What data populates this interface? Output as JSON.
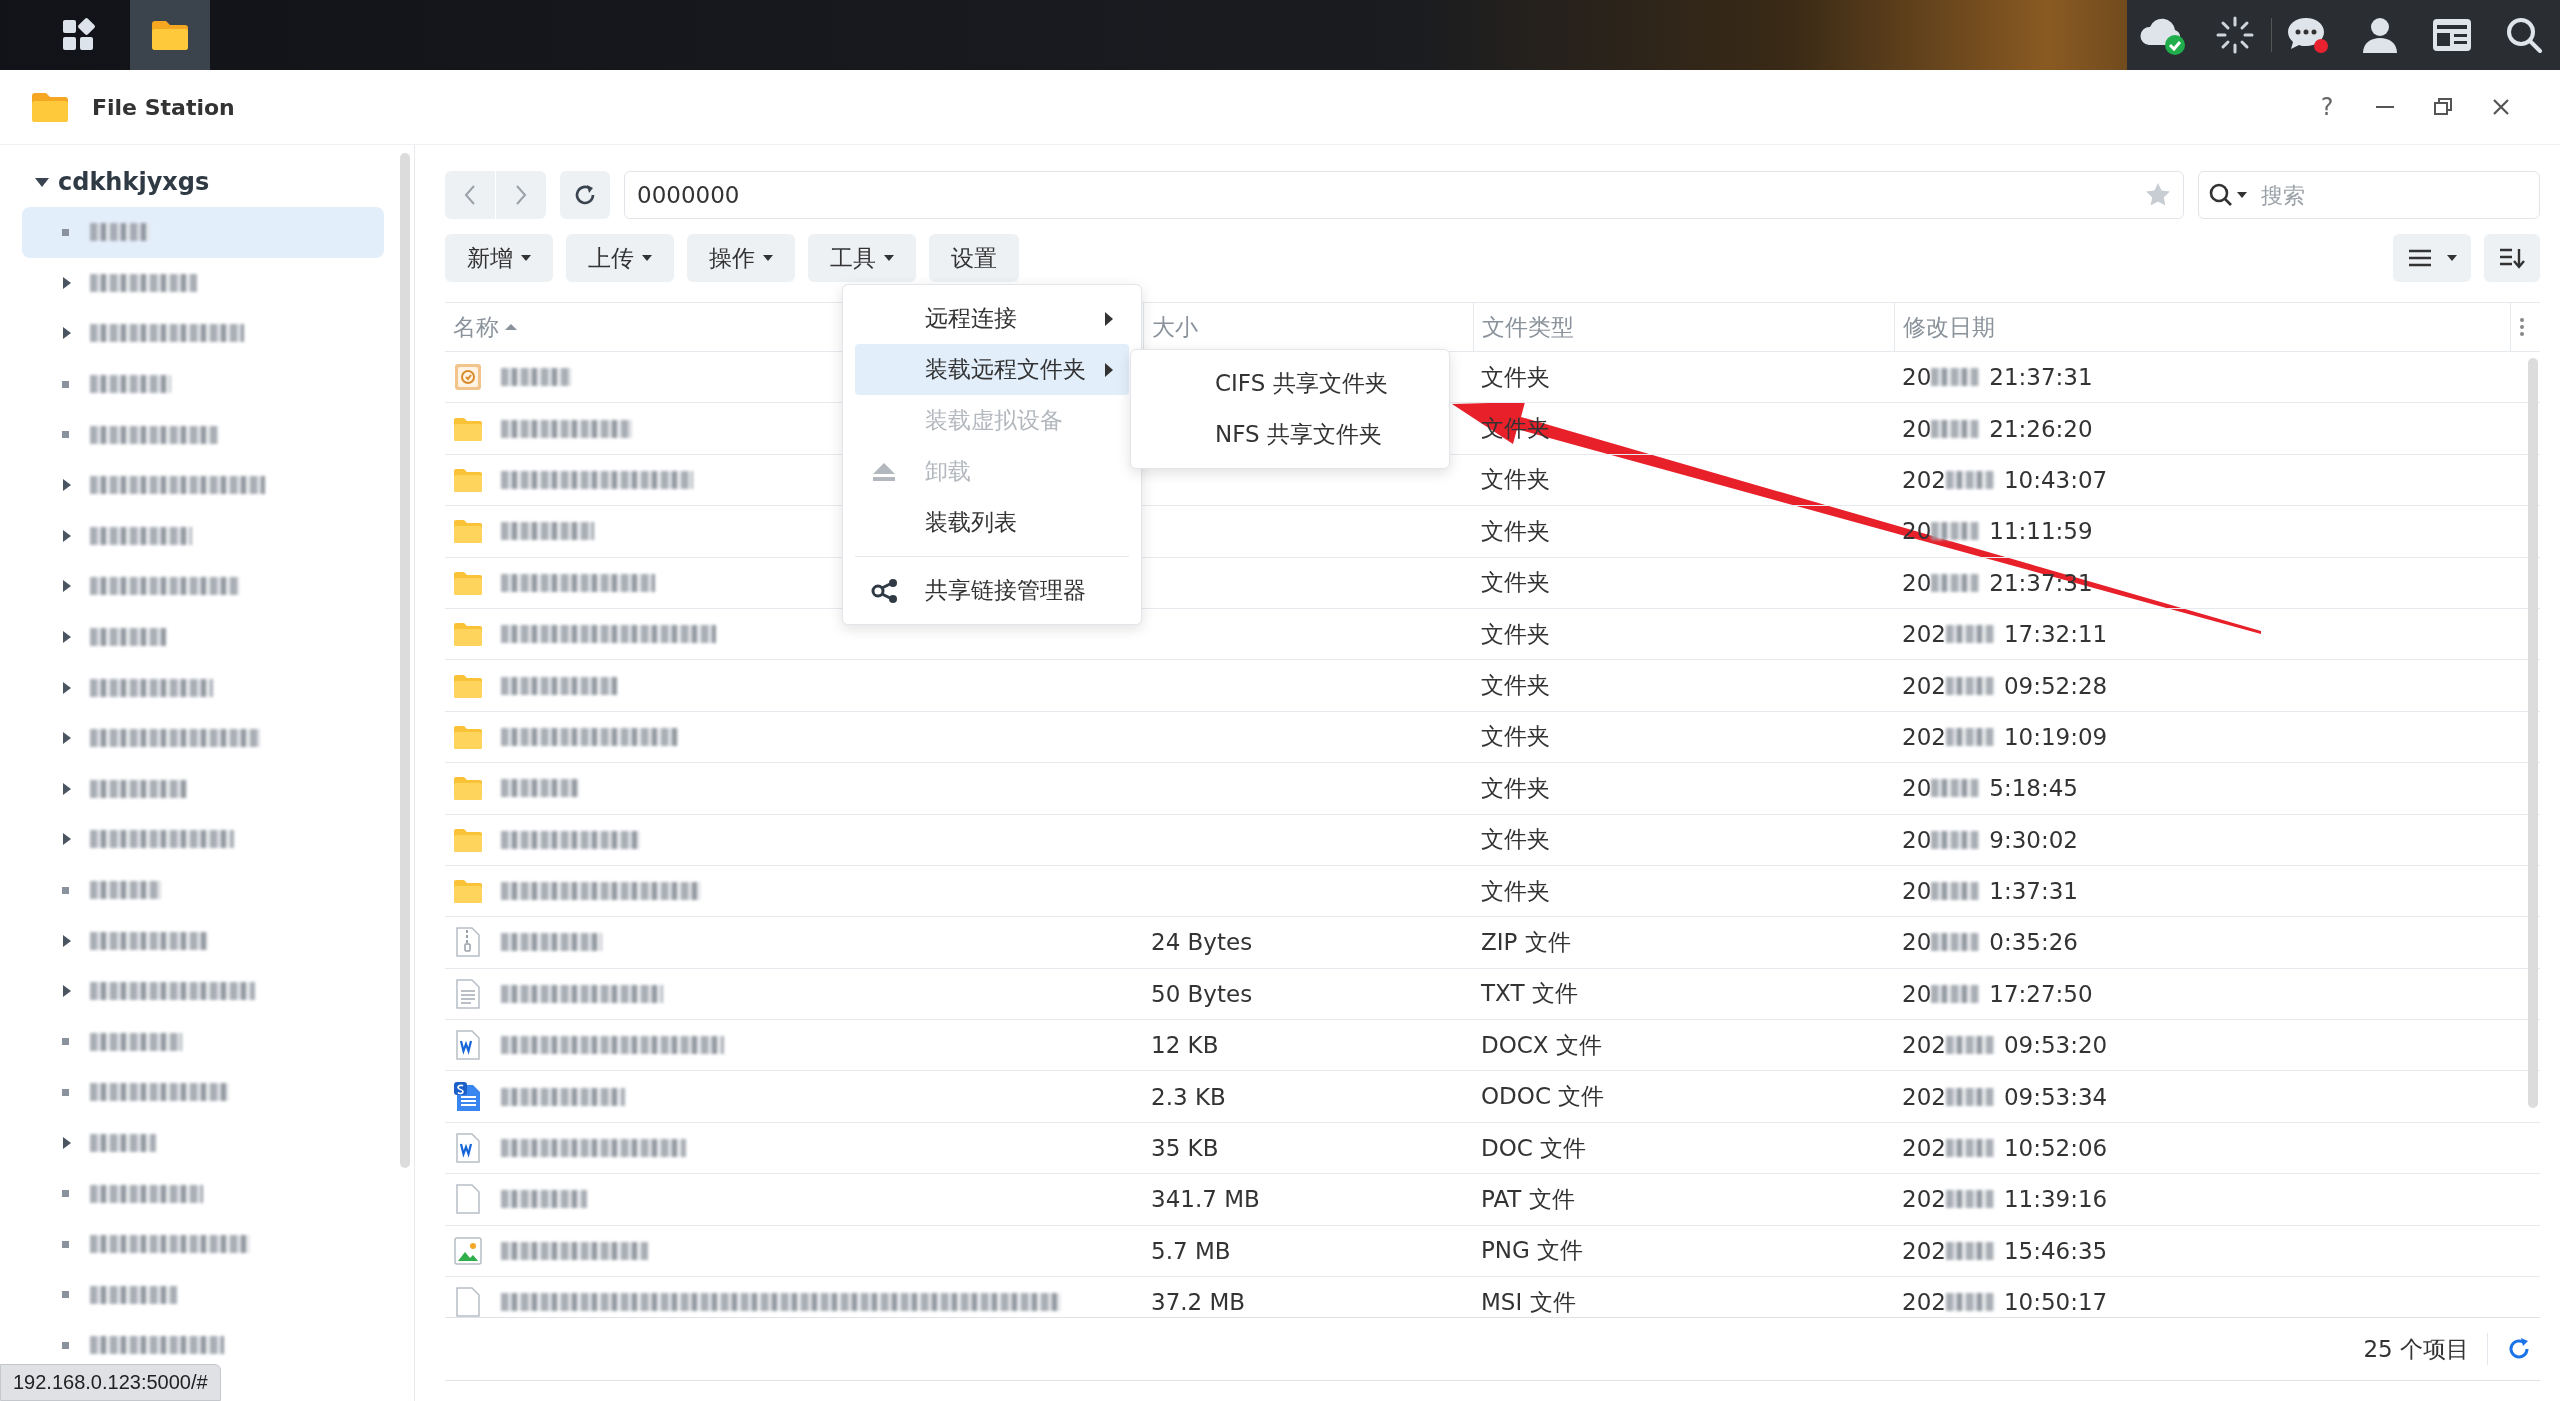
{
  "taskbar": {
    "apps": [
      {
        "kind": "grid",
        "selected": false
      },
      {
        "kind": "folder",
        "selected": true
      }
    ],
    "tray": [
      {
        "kind": "cloud"
      },
      {
        "kind": "spinner"
      },
      {
        "kind": "chat"
      },
      {
        "kind": "user"
      },
      {
        "kind": "widgets"
      },
      {
        "kind": "search"
      }
    ]
  },
  "window": {
    "title": "File Station",
    "help": "?"
  },
  "sidebar": {
    "root": {
      "label": "cdkhkjyxgs",
      "expanded": true,
      "children": [
        {
          "kind": "blurred",
          "selected": true,
          "expandable": false
        },
        {
          "kind": "blurred",
          "selected": false,
          "expandable": true
        },
        {
          "kind": "blurred",
          "selected": false,
          "expandable": true
        },
        {
          "kind": "blurred",
          "selected": false,
          "expandable": false
        },
        {
          "kind": "blurred",
          "selected": false,
          "expandable": false
        },
        {
          "kind": "blurred",
          "selected": false,
          "expandable": true
        },
        {
          "kind": "blurred",
          "selected": false,
          "expandable": true
        },
        {
          "kind": "blurred",
          "selected": false,
          "expandable": true
        },
        {
          "kind": "blurred",
          "selected": false,
          "expandable": true
        },
        {
          "kind": "blurred",
          "selected": false,
          "expandable": true
        },
        {
          "kind": "blurred",
          "selected": false,
          "expandable": true
        },
        {
          "kind": "blurred",
          "selected": false,
          "expandable": true
        },
        {
          "kind": "blurred",
          "selected": false,
          "expandable": true
        },
        {
          "kind": "blurred",
          "selected": false,
          "expandable": false
        },
        {
          "kind": "blurred",
          "selected": false,
          "expandable": true
        },
        {
          "kind": "blurred",
          "selected": false,
          "expandable": true
        },
        {
          "kind": "blurred",
          "selected": false,
          "expandable": false
        },
        {
          "kind": "blurred",
          "selected": false,
          "expandable": false
        },
        {
          "kind": "blurred",
          "selected": false,
          "expandable": true
        },
        {
          "kind": "blurred",
          "selected": false,
          "expandable": false
        },
        {
          "kind": "blurred",
          "selected": false,
          "expandable": false
        },
        {
          "kind": "blurred",
          "selected": false,
          "expandable": false
        },
        {
          "kind": "blurred",
          "selected": false,
          "expandable": false
        }
      ]
    }
  },
  "path": "0000000",
  "search": {
    "placeholder": "搜索"
  },
  "toolbar": [
    {
      "label": "新增",
      "dropdown": true
    },
    {
      "label": "上传",
      "dropdown": true
    },
    {
      "label": "操作",
      "dropdown": true
    },
    {
      "label": "工具",
      "dropdown": true
    },
    {
      "label": "设置",
      "dropdown": false
    }
  ],
  "columns": [
    {
      "label": "名称",
      "sorted": true
    },
    {
      "label": "大小",
      "sorted": false
    },
    {
      "label": "文件类型",
      "sorted": false
    },
    {
      "label": "修改日期",
      "sorted": false
    }
  ],
  "rows": [
    {
      "kind": "recycle",
      "type": "文件夹",
      "date": "20",
      "time": "21:37:31"
    },
    {
      "kind": "folder",
      "type": "文件夹",
      "date": "20",
      "time": "21:26:20"
    },
    {
      "kind": "folder",
      "type": "文件夹",
      "date": "202",
      "time": "10:43:07"
    },
    {
      "kind": "folder",
      "type": "文件夹",
      "date": "20",
      "time": "11:11:59"
    },
    {
      "kind": "folder",
      "type": "文件夹",
      "date": "20",
      "time": "21:37:31"
    },
    {
      "kind": "folder",
      "type": "文件夹",
      "date": "202",
      "time": "17:32:11"
    },
    {
      "kind": "folder",
      "type": "文件夹",
      "date": "202",
      "time": "09:52:28"
    },
    {
      "kind": "folder",
      "type": "文件夹",
      "date": "202",
      "time": "10:19:09"
    },
    {
      "kind": "folder",
      "type": "文件夹",
      "date": "20",
      "time": "5:18:45"
    },
    {
      "kind": "folder",
      "type": "文件夹",
      "date": "20",
      "time": "9:30:02"
    },
    {
      "kind": "folder",
      "type": "文件夹",
      "date": "20",
      "time": "1:37:31"
    },
    {
      "kind": "zip",
      "size": "24 Bytes",
      "type": "ZIP 文件",
      "date": "20",
      "time": "0:35:26"
    },
    {
      "kind": "text",
      "size": "50 Bytes",
      "type": "TXT 文件",
      "date": "20",
      "time": "17:27:50"
    },
    {
      "kind": "word",
      "size": "12 KB",
      "type": "DOCX 文件",
      "date": "202",
      "time": "09:53:20"
    },
    {
      "kind": "doc",
      "size": "2.3 KB",
      "type": "ODOC 文件",
      "date": "202",
      "time": "09:53:34"
    },
    {
      "kind": "word",
      "size": "35 KB",
      "type": "DOC 文件",
      "date": "202",
      "time": "10:52:06"
    },
    {
      "kind": "blank",
      "size": "341.7 MB",
      "type": "PAT 文件",
      "date": "202",
      "time": "11:39:16"
    },
    {
      "kind": "image",
      "size": "5.7 MB",
      "type": "PNG 文件",
      "date": "202",
      "time": "15:46:35"
    },
    {
      "kind": "blank",
      "size": "37.2 MB",
      "type": "MSI 文件",
      "date": "202",
      "time": "10:50:17"
    }
  ],
  "footer": {
    "count": "25 个项目"
  },
  "menu": {
    "items": [
      {
        "kind": "item",
        "label": "远程连接",
        "submenu": true,
        "selected": false,
        "disabled": false
      },
      {
        "kind": "item",
        "label": "装载远程文件夹",
        "submenu": true,
        "selected": true,
        "disabled": false
      },
      {
        "kind": "item",
        "label": "装载虚拟设备",
        "submenu": false,
        "selected": false,
        "disabled": true
      },
      {
        "kind": "eject",
        "label": "卸载",
        "submenu": false,
        "selected": false,
        "disabled": true
      },
      {
        "kind": "item",
        "label": "装载列表",
        "submenu": false,
        "selected": false,
        "disabled": false
      },
      {
        "kind": "separator"
      },
      {
        "kind": "share",
        "label": "共享链接管理器",
        "submenu": false,
        "selected": false,
        "disabled": false
      }
    ]
  },
  "submenu": {
    "items": [
      {
        "label": "CIFS 共享文件夹"
      },
      {
        "label": "NFS 共享文件夹"
      }
    ]
  },
  "status_url": "192.168.0.123:5000/#"
}
